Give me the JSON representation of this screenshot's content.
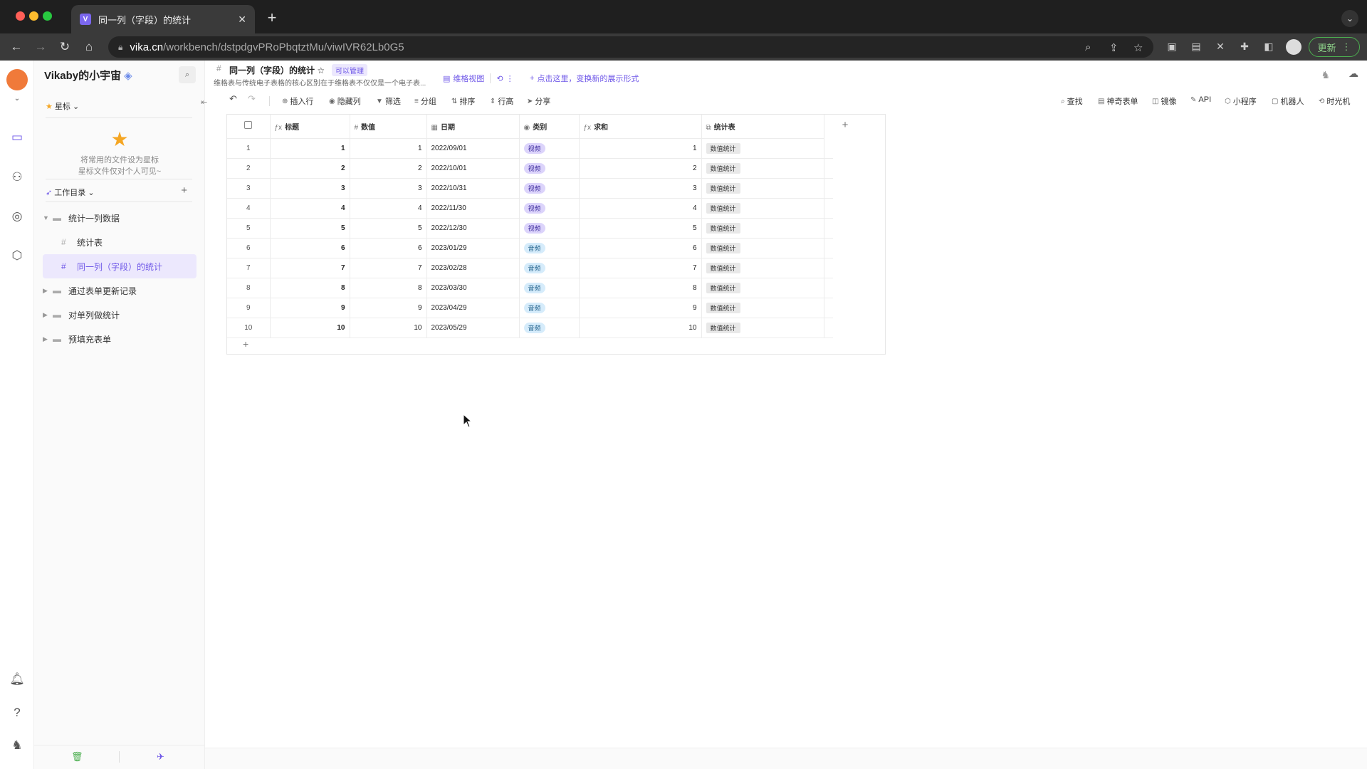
{
  "browser": {
    "tab_title": "同一列（字段）的统计",
    "url_host": "vika.cn",
    "url_path": "/workbench/dstpdgvPRoPbqtztMu/viwIVR62Lb0G5",
    "update_label": "更新"
  },
  "sidebar": {
    "space_name": "Vikaby的小宇宙",
    "star_label": "星标",
    "star_hint_1": "将常用的文件设为星标",
    "star_hint_2": "星标文件仅对个人可见~",
    "workdir_label": "工作目录",
    "tree": [
      {
        "label": "统计一列数据",
        "type": "folder",
        "expanded": true
      },
      {
        "label": "统计表",
        "type": "sheet"
      },
      {
        "label": "同一列（字段）的统计",
        "type": "sheet",
        "active": true
      },
      {
        "label": "通过表单更新记录",
        "type": "folder"
      },
      {
        "label": "对单列做统计",
        "type": "folder"
      },
      {
        "label": "预填充表单",
        "type": "folder"
      }
    ]
  },
  "header": {
    "title": "同一列（字段）的统计",
    "permission": "可以管理",
    "description": "维格表与传统电子表格的核心区别在于维格表不仅仅是一个电子表...",
    "view_name": "维格视图",
    "add_view_label": "点击这里，变换新的展示形式"
  },
  "toolbar": {
    "insert_row": "插入行",
    "hide_fields": "隐藏列",
    "filter": "筛选",
    "group": "分组",
    "sort": "排序",
    "row_height": "行高",
    "share": "分享",
    "search": "查找",
    "form": "神奇表单",
    "mirror": "镜像",
    "api": "API",
    "widget": "小程序",
    "robot": "机器人",
    "timemachine": "时光机"
  },
  "grid": {
    "columns": [
      "标题",
      "数值",
      "日期",
      "类别",
      "求和",
      "统计表"
    ],
    "rows": [
      {
        "idx": "1",
        "title": "1",
        "value": "1",
        "date": "2022/09/01",
        "cat": "视频",
        "sum": "1",
        "link": "数值统计"
      },
      {
        "idx": "2",
        "title": "2",
        "value": "2",
        "date": "2022/10/01",
        "cat": "视频",
        "sum": "2",
        "link": "数值统计"
      },
      {
        "idx": "3",
        "title": "3",
        "value": "3",
        "date": "2022/10/31",
        "cat": "视频",
        "sum": "3",
        "link": "数值统计"
      },
      {
        "idx": "4",
        "title": "4",
        "value": "4",
        "date": "2022/11/30",
        "cat": "视频",
        "sum": "4",
        "link": "数值统计"
      },
      {
        "idx": "5",
        "title": "5",
        "value": "5",
        "date": "2022/12/30",
        "cat": "视频",
        "sum": "5",
        "link": "数值统计"
      },
      {
        "idx": "6",
        "title": "6",
        "value": "6",
        "date": "2023/01/29",
        "cat": "音频",
        "sum": "6",
        "link": "数值统计"
      },
      {
        "idx": "7",
        "title": "7",
        "value": "7",
        "date": "2023/02/28",
        "cat": "音频",
        "sum": "7",
        "link": "数值统计"
      },
      {
        "idx": "8",
        "title": "8",
        "value": "8",
        "date": "2023/03/30",
        "cat": "音频",
        "sum": "8",
        "link": "数值统计"
      },
      {
        "idx": "9",
        "title": "9",
        "value": "9",
        "date": "2023/04/29",
        "cat": "音频",
        "sum": "9",
        "link": "数值统计"
      },
      {
        "idx": "10",
        "title": "10",
        "value": "10",
        "date": "2023/05/29",
        "cat": "音频",
        "sum": "10",
        "link": "数值统计"
      }
    ]
  },
  "colors": {
    "accent": "#6f58e8",
    "tag_video_bg": "#dcd4fb",
    "tag_audio_bg": "#d6ecfb"
  }
}
